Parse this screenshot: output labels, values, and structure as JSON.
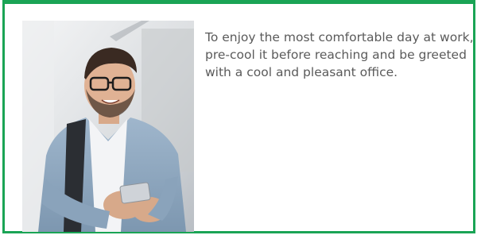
{
  "card": {
    "border_color": "#1aa455",
    "image": {
      "icon": "photo-man-smiling-at-phone"
    },
    "description": "To enjoy the most comfortable day at work, pre-cool it before reaching and be greeted with a cool and pleasant office."
  }
}
